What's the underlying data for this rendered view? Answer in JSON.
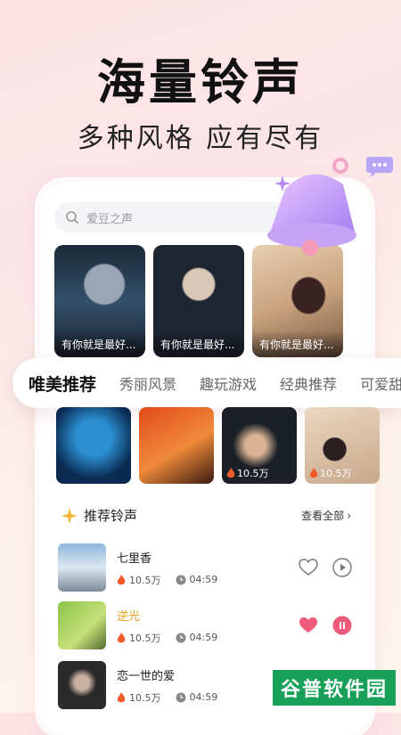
{
  "hero": {
    "title": "海量铃声",
    "subtitle": "多种风格 应有尽有"
  },
  "search": {
    "placeholder": "爱豆之声"
  },
  "featured": [
    {
      "caption": "有你就是最好..."
    },
    {
      "caption": "有你就是最好..."
    },
    {
      "caption": "有你就是最好..."
    }
  ],
  "categories": [
    "唯美推荐",
    "秀丽风景",
    "趣玩游戏",
    "经典推荐",
    "可爱甜"
  ],
  "thumbnails": [
    {
      "count": ""
    },
    {
      "count": ""
    },
    {
      "count": "10.5万"
    },
    {
      "count": "10.5万"
    }
  ],
  "section": {
    "title": "推荐铃声",
    "more": "查看全部"
  },
  "songs": [
    {
      "name": "七里香",
      "plays": "10.5万",
      "duration": "04:59",
      "liked": false,
      "playing": false
    },
    {
      "name": "逆光",
      "plays": "10.5万",
      "duration": "04:59",
      "liked": true,
      "playing": true
    },
    {
      "name": "恋一世的爱",
      "plays": "10.5万",
      "duration": "04:59",
      "liked": false,
      "playing": false
    }
  ],
  "watermark": {
    "text": "谷普软件园"
  },
  "colors": {
    "accent_pink": "#ef5a7a",
    "highlight_orange": "#e8a020",
    "flame": "#f05a28"
  }
}
